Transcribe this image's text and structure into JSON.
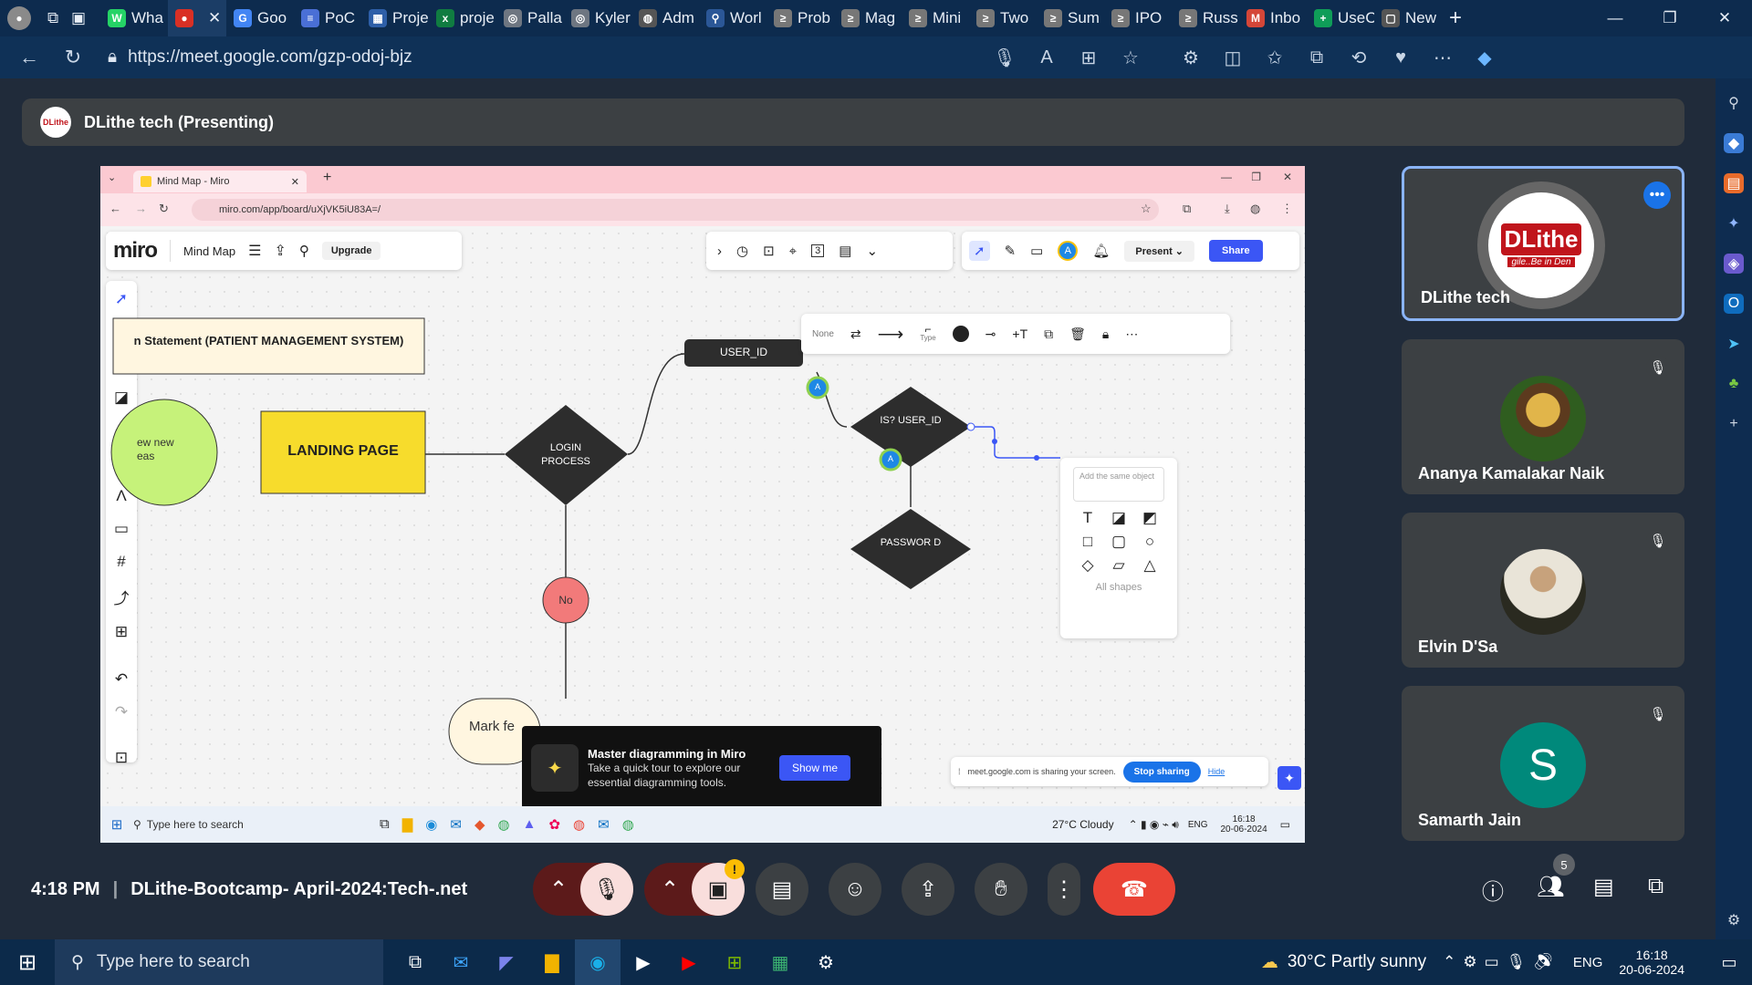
{
  "browser": {
    "tabs": [
      {
        "label": "Wha",
        "color": "#25d366",
        "glyph": "W"
      },
      {
        "label": "",
        "color": "#d93025",
        "glyph": "●",
        "active": true
      },
      {
        "label": "Goo",
        "color": "#4285f4",
        "glyph": "G"
      },
      {
        "label": "PoC",
        "color": "#4a6fd6",
        "glyph": "≡"
      },
      {
        "label": "Proje",
        "color": "#2e5fa8",
        "glyph": "▦"
      },
      {
        "label": "proje",
        "color": "#107c41",
        "glyph": "x"
      },
      {
        "label": "Palla",
        "color": "#6e7681",
        "glyph": "◎"
      },
      {
        "label": "Kyler",
        "color": "#6e7681",
        "glyph": "◎"
      },
      {
        "label": "Adm",
        "color": "#555",
        "glyph": "◍"
      },
      {
        "label": "Worl",
        "color": "#2b5797",
        "glyph": "⚲"
      },
      {
        "label": "Prob",
        "color": "#777",
        "glyph": "≥"
      },
      {
        "label": "Mag",
        "color": "#777",
        "glyph": "≥"
      },
      {
        "label": "Mini",
        "color": "#777",
        "glyph": "≥"
      },
      {
        "label": "Two",
        "color": "#777",
        "glyph": "≥"
      },
      {
        "label": "Sum",
        "color": "#777",
        "glyph": "≥"
      },
      {
        "label": "IPO",
        "color": "#777",
        "glyph": "≥"
      },
      {
        "label": "Russ",
        "color": "#777",
        "glyph": "≥"
      },
      {
        "label": "Inbo",
        "color": "#d44638",
        "glyph": "M"
      },
      {
        "label": "UseC",
        "color": "#0f9d58",
        "glyph": "+"
      },
      {
        "label": "New",
        "color": "#555",
        "glyph": "▢"
      }
    ],
    "url": "https://meet.google.com/gzp-odoj-bjz"
  },
  "meet": {
    "presenter_banner": "DLithe tech (Presenting)",
    "logo_text": "DLithe",
    "time": "4:18 PM",
    "meeting_name": "DLithe-Bootcamp- April-2024:Tech-.net",
    "participant_count": "5",
    "participants": [
      {
        "name": "DLithe tech",
        "avatar": "DLithe",
        "tagline": "gile..Be in Den"
      },
      {
        "name": "Ananya Kamalakar Naik"
      },
      {
        "name": "Elvin D'Sa"
      },
      {
        "name": "Samarth Jain",
        "initial": "S"
      }
    ],
    "colors": {
      "end_call": "#ea4335",
      "muted": "#f9dedc",
      "accent": "#8ab4f8",
      "samarth": "#00897b"
    }
  },
  "shared": {
    "tab_title": "Mind Map - Miro",
    "url": "miro.com/app/board/uXjVK5iU83A=/",
    "miro_logo": "miro",
    "board_name": "Mind Map",
    "upgrade": "Upgrade",
    "present": "Present",
    "share": "Share",
    "avatar_letter": "A",
    "counter": "3",
    "line_toolbar": {
      "none": "None",
      "type": "Type"
    },
    "nodes": {
      "problem": "n Statement (PATIENT MANAGEMENT SYSTEM)",
      "ideas": "ew new eas",
      "landing": "LANDING PAGE",
      "login": "LOGIN PROCESS",
      "user_id": "USER_ID",
      "is_user": "IS? USER_ID",
      "password": "PASSWOR D",
      "no": "No",
      "mark": "Mark fe"
    },
    "shape_picker": {
      "hint": "Add the same object",
      "all": "All shapes"
    },
    "promo": {
      "title": "Master diagramming in Miro",
      "body": "Take a quick tour to explore our essential diagramming tools.",
      "button": "Show me"
    },
    "sharing": {
      "text": "meet.google.com is sharing your screen.",
      "stop": "Stop sharing",
      "hide": "Hide"
    },
    "taskbar": {
      "search": "Type here to search",
      "weather": "27°C  Cloudy",
      "lang": "ENG",
      "time": "16:18",
      "date": "20-06-2024"
    }
  },
  "taskbar": {
    "search": "Type here to search",
    "weather": "30°C  Partly sunny",
    "lang": "ENG",
    "time": "16:18",
    "date": "20-06-2024"
  }
}
